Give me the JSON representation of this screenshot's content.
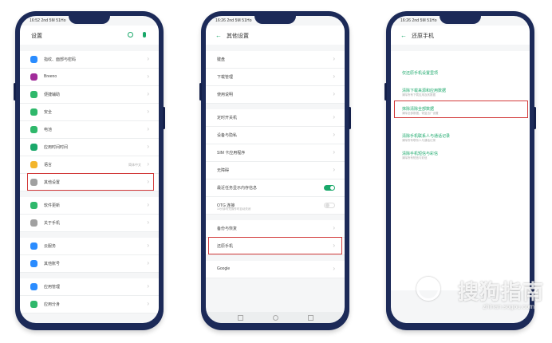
{
  "phone1": {
    "status": "16:52 2nd 5M 51Ho",
    "title": "设置",
    "items": [
      {
        "label": "指纹、面部与密码",
        "color": "#2a8cff"
      },
      {
        "label": "Breeno",
        "color": "#a12b9a"
      },
      {
        "label": "便捷辅助",
        "color": "#2fb86b"
      },
      {
        "label": "安全",
        "color": "#2fb86b"
      },
      {
        "label": "电池",
        "color": "#2fb86b"
      },
      {
        "label": "应用时间时间",
        "color": "#1aa86a"
      },
      {
        "label": "语言",
        "value": "简体中文",
        "color": "#f3b52b"
      },
      {
        "label": "其他设置",
        "color": "#a0a0a0"
      },
      {
        "label": "软件更新",
        "color": "#2fb86b"
      },
      {
        "label": "关于手机",
        "color": "#a0a0a0"
      },
      {
        "label": "云服务",
        "color": "#2a8cff"
      },
      {
        "label": "其他账号",
        "color": "#2a8cff"
      },
      {
        "label": "应用管理",
        "color": "#2a8cff"
      },
      {
        "label": "应用分身",
        "color": "#2fb86b"
      }
    ]
  },
  "phone2": {
    "status": "16:26 2nd 5M 51Ho",
    "title": "其他设置",
    "items": [
      {
        "label": "键盘"
      },
      {
        "label": "下载管理"
      },
      {
        "label": "使用说明"
      },
      {
        "label": "定时开关机"
      },
      {
        "label": "设备与隐私"
      },
      {
        "label": "SIM 卡应用程序"
      },
      {
        "label": "无障碍"
      },
      {
        "label": "最近任务显示内存信息",
        "toggle": "on"
      },
      {
        "label": "OTG 连接",
        "sub": "10分钟内无操作时自动关闭",
        "toggle": "off"
      },
      {
        "label": "备份与恢复"
      },
      {
        "label": "还原手机"
      },
      {
        "label": "Google"
      }
    ]
  },
  "phone3": {
    "status": "16:26 2nd 5M 51Ho",
    "title": "还原手机",
    "items": [
      {
        "label": "仅还原手机设置里项"
      },
      {
        "label": "清除下载来源和应用数据",
        "sub": "清除所有下载应用及其数据"
      },
      {
        "label": "抹除清除全部数据",
        "sub": "清除全部数据，恢复出厂设置"
      },
      {
        "label": "清除手机联系人与通话记录",
        "sub": "清除所有联系人与通话记录"
      },
      {
        "label": "清除手机短信与彩信",
        "sub": "清除所有短信与彩信"
      }
    ]
  },
  "watermark": {
    "brand": "搜狗指南",
    "url": "zhinan.sogou.com"
  }
}
